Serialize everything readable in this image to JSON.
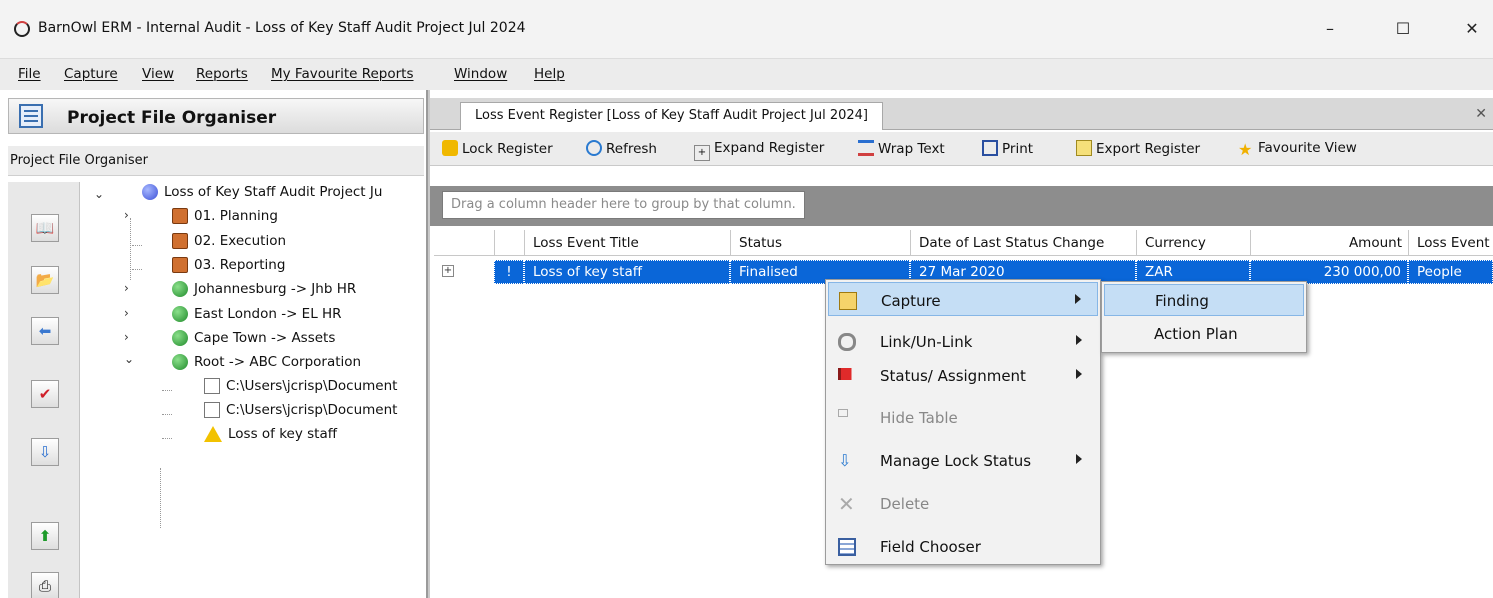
{
  "window": {
    "title": "BarnOwl ERM - Internal Audit - Loss of Key Staff Audit Project Jul 2024",
    "minimize": "–",
    "maximize": "☐",
    "close": "✕"
  },
  "menubar": [
    "File",
    "Capture",
    "View",
    "Reports",
    "My Favourite Reports",
    "Window",
    "Help"
  ],
  "left_panel": {
    "title": "Project File Organiser",
    "subtitle": "Project File Organiser",
    "tree": [
      {
        "label": "Loss of Key Staff Audit Project Ju",
        "icon": "blue-globe-icon"
      },
      {
        "label": "01. Planning",
        "icon": "folder-icon"
      },
      {
        "label": "02. Execution",
        "icon": "folder-icon"
      },
      {
        "label": "03. Reporting",
        "icon": "folder-icon"
      },
      {
        "label": "Johannesburg -> Jhb HR",
        "icon": "green-globe-icon"
      },
      {
        "label": "East London -> EL HR",
        "icon": "green-globe-icon"
      },
      {
        "label": "Cape Town -> Assets",
        "icon": "green-globe-icon"
      },
      {
        "label": "Root -> ABC Corporation",
        "icon": "green-globe-icon"
      },
      {
        "label": "C:\\Users\\jcrisp\\Document",
        "icon": "document-icon"
      },
      {
        "label": "C:\\Users\\jcrisp\\Document",
        "icon": "document-icon"
      },
      {
        "label": "Loss of key staff",
        "icon": "warning-icon"
      }
    ],
    "expanders": {
      "open": "⌄",
      "closed": "›"
    }
  },
  "tab": {
    "label": "Loss Event Register [Loss of Key Staff Audit Project Jul 2024]",
    "close": "✕"
  },
  "toolbar": {
    "lock": "Lock Register",
    "refresh": "Refresh",
    "expand": "Expand Register",
    "wrap": "Wrap Text",
    "print": "Print",
    "export": "Export Register",
    "favourite": "Favourite View"
  },
  "grid": {
    "group_hint": "Drag a column header here to group by that column.",
    "columns": [
      "Loss Event Title",
      "Status",
      "Date of Last Status Change",
      "Currency",
      "Amount",
      "Loss Event"
    ],
    "row": {
      "expand": "+",
      "flag": "!",
      "title": "Loss of key staff",
      "status": "Finalised",
      "date": "27 Mar 2020",
      "currency": "ZAR",
      "amount": "230 000,00",
      "category": "People"
    }
  },
  "context_menu": {
    "items": [
      {
        "label": "Capture",
        "icon": "capture-icon"
      },
      {
        "label": "Link/Un-Link",
        "icon": "link-icon"
      },
      {
        "label": "Status/ Assignment",
        "icon": "flag-icon"
      },
      {
        "label": "Hide Table",
        "icon": "hide-table-icon"
      },
      {
        "label": "Manage Lock Status",
        "icon": "lock-status-icon"
      },
      {
        "label": "Delete",
        "icon": "delete-icon"
      },
      {
        "label": "Field Chooser",
        "icon": "field-chooser-icon"
      }
    ],
    "submenu": [
      "Finding",
      "Action Plan"
    ]
  },
  "colors": {
    "selection": "#0a66d8",
    "menu_highlight": "#c5def5"
  }
}
